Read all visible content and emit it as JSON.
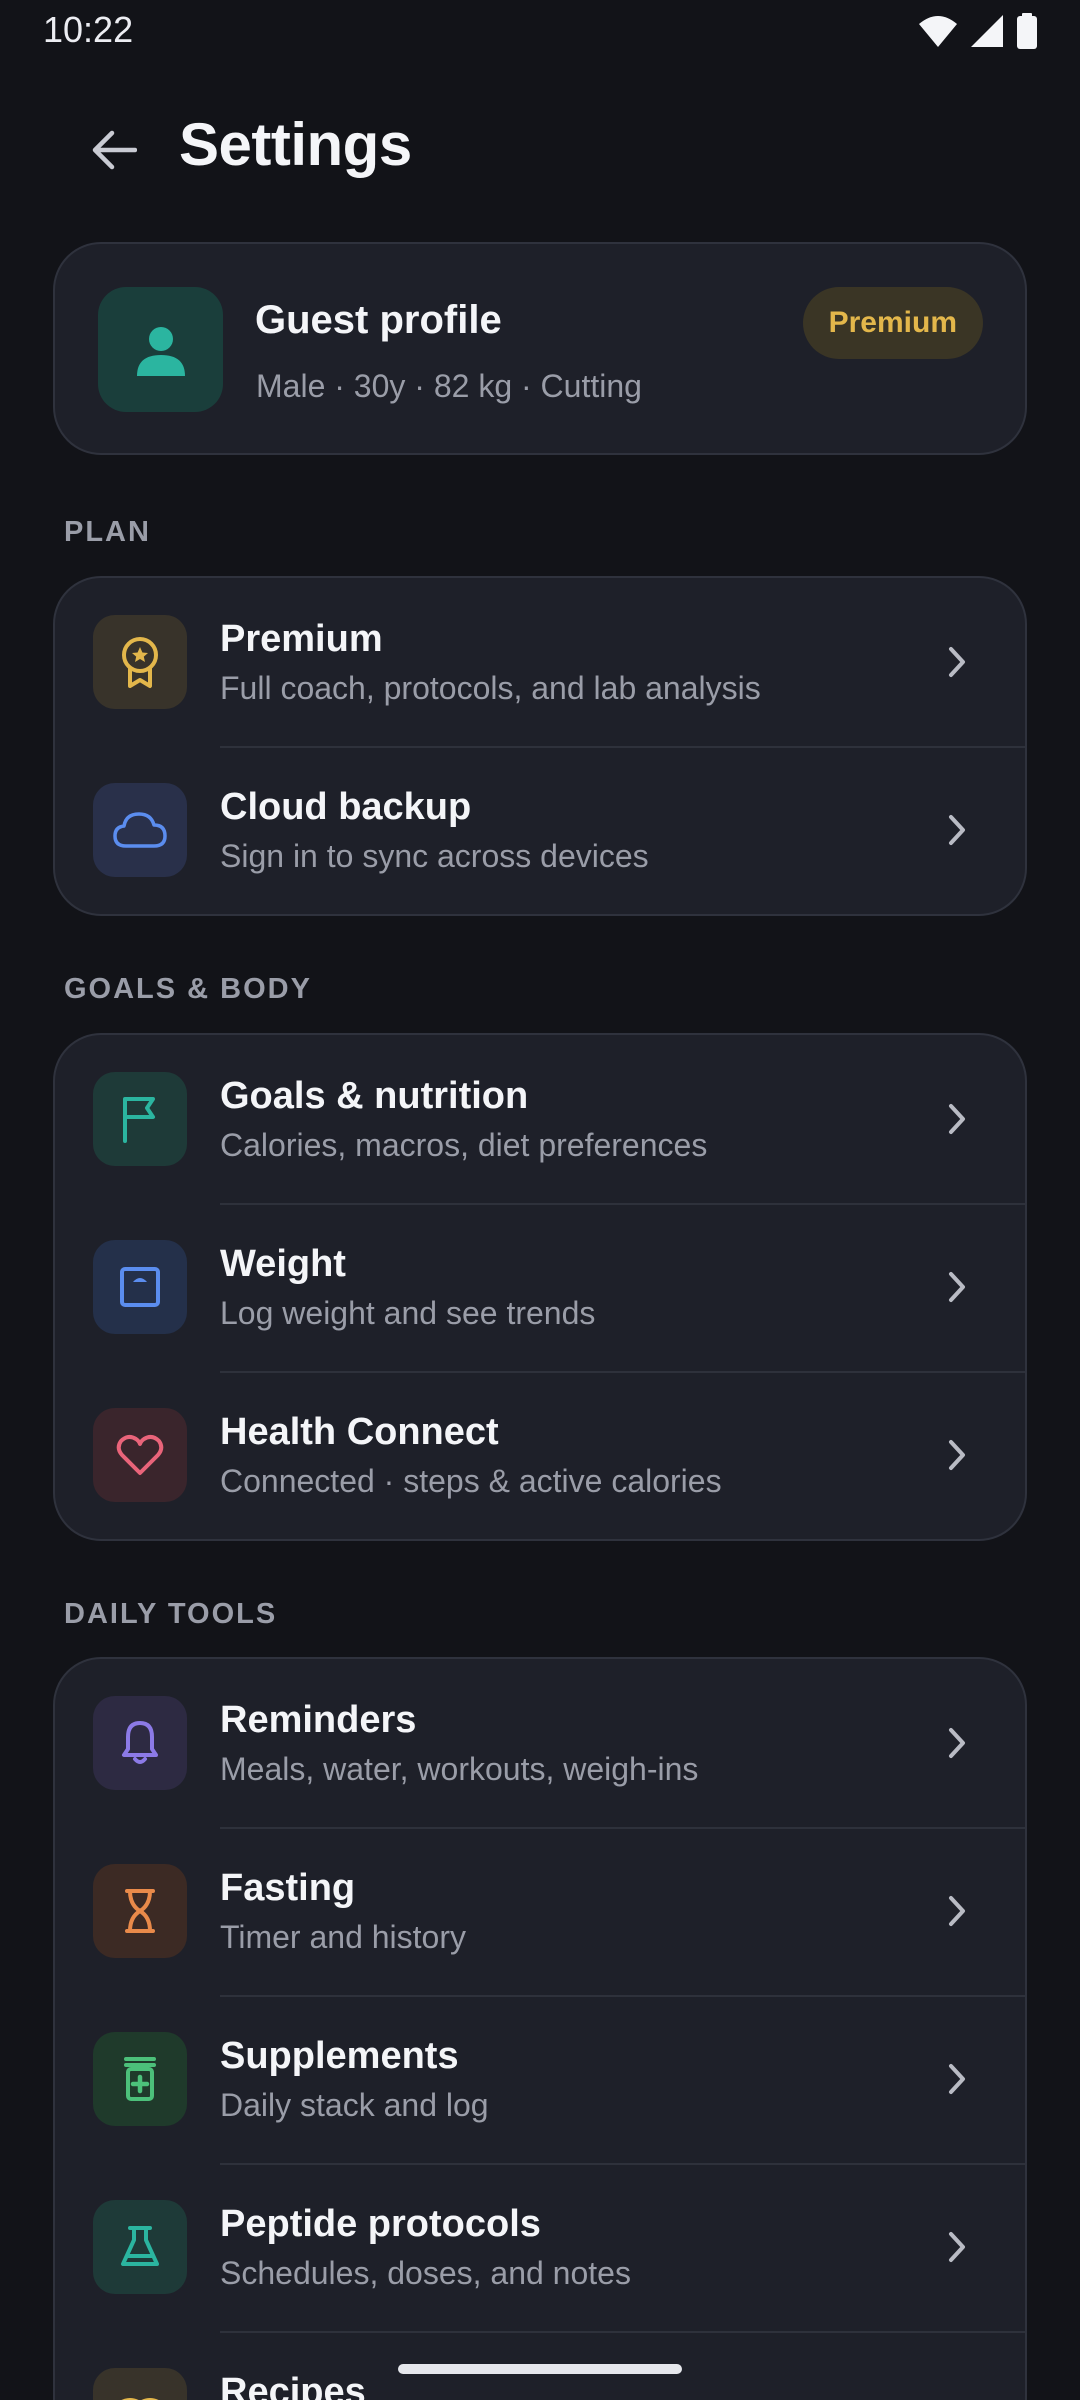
{
  "status_bar": {
    "time": "10:22"
  },
  "header": {
    "title": "Settings"
  },
  "profile": {
    "name": "Guest profile",
    "meta": "Male · 30y · 82 kg · Cutting",
    "badge": "Premium"
  },
  "colors": {
    "background": "#121318",
    "card": "#1E2029",
    "accent_teal": "#2BB5A0",
    "accent_gold": "#E3B74B",
    "accent_blue": "#5B8DEF",
    "accent_pink": "#E9647A",
    "accent_purple": "#8C7AE6",
    "accent_orange": "#E98A4A",
    "accent_green": "#4CC07A"
  },
  "sections": [
    {
      "label": "PLAN",
      "items": [
        {
          "title": "Premium",
          "subtitle": "Full coach, protocols, and lab analysis",
          "icon": "award-icon"
        },
        {
          "title": "Cloud backup",
          "subtitle": "Sign in to sync across devices",
          "icon": "cloud-icon"
        }
      ]
    },
    {
      "label": "GOALS & BODY",
      "items": [
        {
          "title": "Goals & nutrition",
          "subtitle": "Calories, macros, diet preferences",
          "icon": "flag-icon"
        },
        {
          "title": "Weight",
          "subtitle": "Log weight and see trends",
          "icon": "scale-icon"
        },
        {
          "title": "Health Connect",
          "subtitle": "Connected · steps & active calories",
          "icon": "heart-icon"
        }
      ]
    },
    {
      "label": "DAILY TOOLS",
      "items": [
        {
          "title": "Reminders",
          "subtitle": "Meals, water, workouts, weigh-ins",
          "icon": "bell-icon"
        },
        {
          "title": "Fasting",
          "subtitle": "Timer and history",
          "icon": "hourglass-icon"
        },
        {
          "title": "Supplements",
          "subtitle": "Daily stack and log",
          "icon": "pill-bottle-icon"
        },
        {
          "title": "Peptide protocols",
          "subtitle": "Schedules, doses, and notes",
          "icon": "flask-icon"
        },
        {
          "title": "Recipes",
          "subtitle": "",
          "icon": "recipe-icon"
        }
      ]
    }
  ]
}
